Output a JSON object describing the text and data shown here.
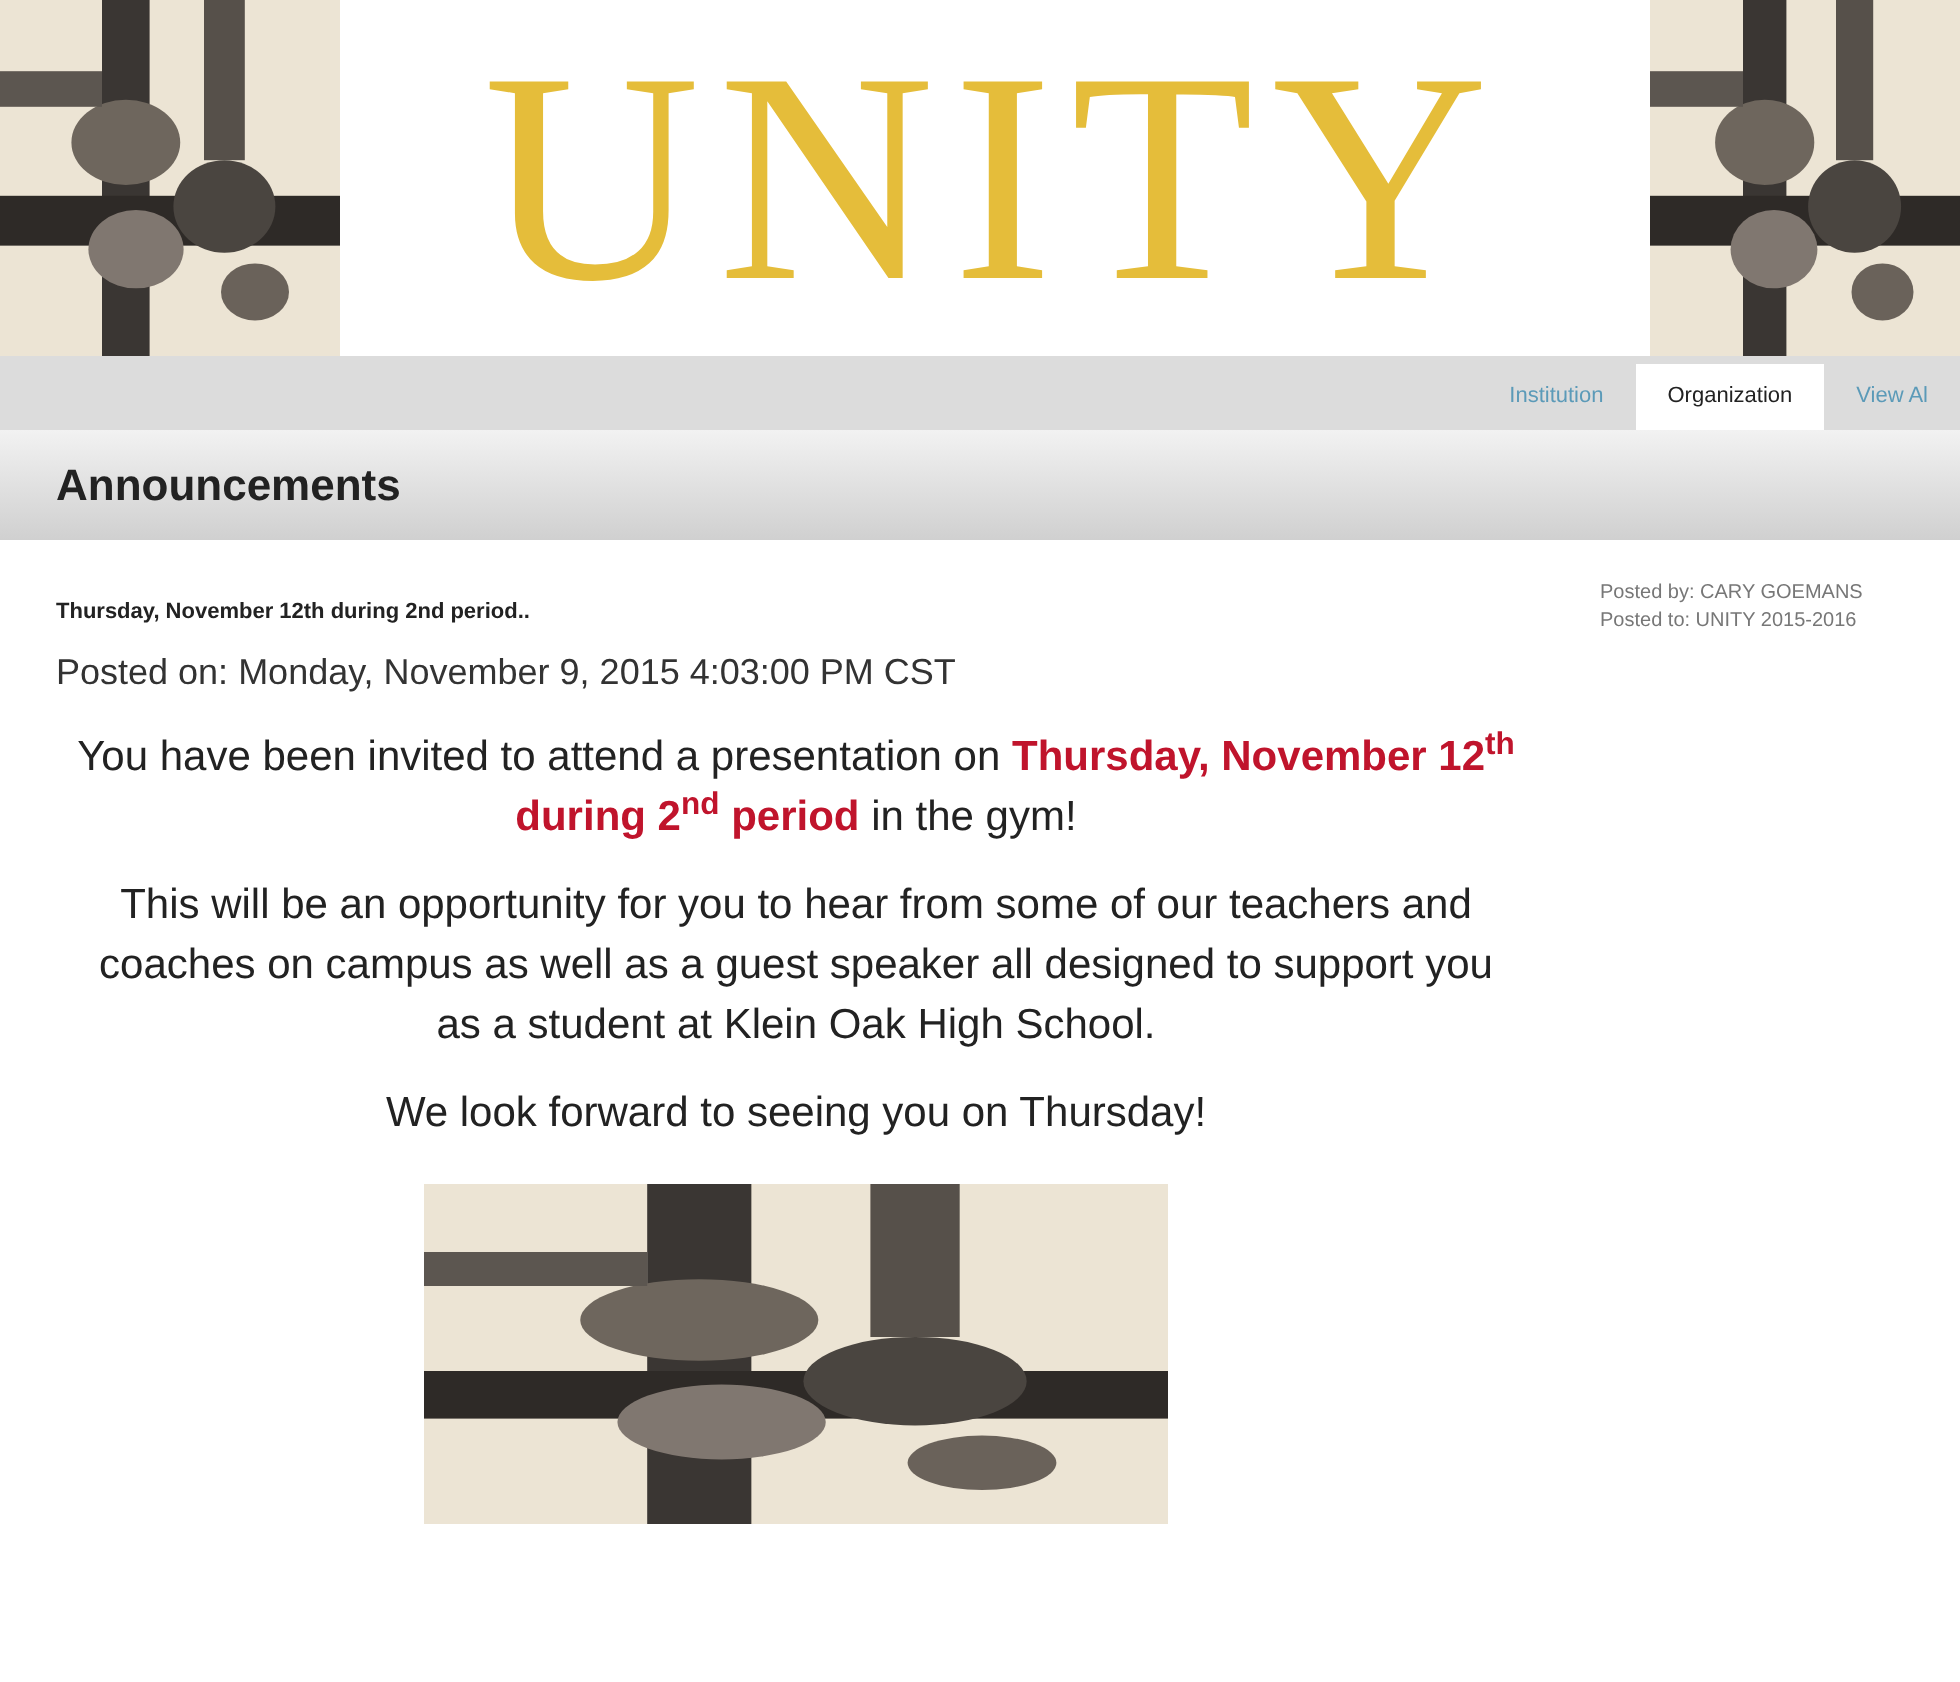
{
  "banner": {
    "title": "UNITY"
  },
  "tabs": [
    {
      "label": "Institution",
      "selected": false
    },
    {
      "label": "Organization",
      "selected": true
    },
    {
      "label": "View Al",
      "selected": false
    }
  ],
  "section_title": "Announcements",
  "announcement": {
    "subject": "Thursday, November 12th during 2nd period..",
    "posted_on": "Posted on: Monday, November 9, 2015 4:03:00 PM CST",
    "paragraphs": [
      "You have been invited to attend a presentation on **Thursday, November 12**$^{th}$ **during 2**$^{nd}$ **period** in the gym!",
      "This will be an opportunity for you to hear from some of our teachers and coaches on campus as well as a guest speaker all designed to support you as a student at Klein Oak High School.",
      "We look forward to seeing you on Thursday!"
    ]
  },
  "meta": {
    "posted_by": "Posted by: CARY GOEMANS",
    "posted_to": "Posted to: UNITY 2015-2016"
  }
}
